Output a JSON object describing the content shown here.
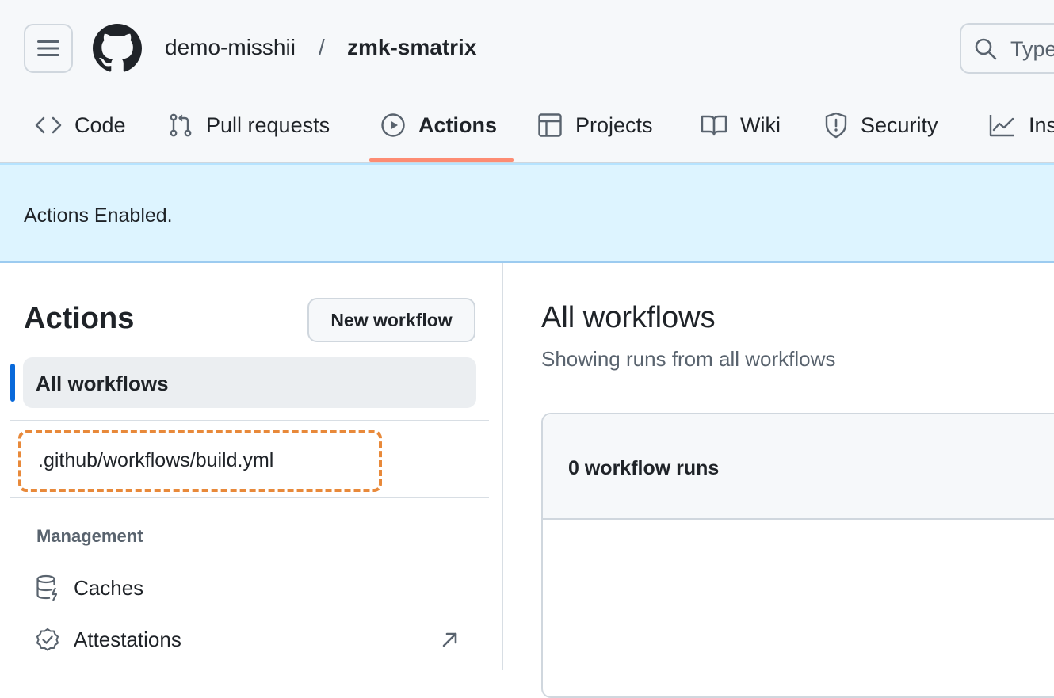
{
  "header": {
    "owner": "demo-misshii",
    "separator": "/",
    "repo": "zmk-smatrix",
    "search_placeholder": "Type"
  },
  "tabs": [
    {
      "label": "Code",
      "icon": "code-icon"
    },
    {
      "label": "Pull requests",
      "icon": "git-pull-request-icon"
    },
    {
      "label": "Actions",
      "icon": "play-icon",
      "active": true
    },
    {
      "label": "Projects",
      "icon": "table-icon"
    },
    {
      "label": "Wiki",
      "icon": "book-icon"
    },
    {
      "label": "Security",
      "icon": "shield-icon"
    },
    {
      "label": "Insights",
      "icon": "graph-icon"
    }
  ],
  "banner": {
    "text": "Actions Enabled."
  },
  "sidebar": {
    "title": "Actions",
    "new_workflow_label": "New workflow",
    "all_workflows_label": "All workflows",
    "workflows": [
      ".github/workflows/build.yml"
    ],
    "management_heading": "Management",
    "management_items": [
      {
        "label": "Caches",
        "icon": "database-icon"
      },
      {
        "label": "Attestations",
        "icon": "verified-icon",
        "external": true
      }
    ]
  },
  "main": {
    "title": "All workflows",
    "subtitle": "Showing runs from all workflows",
    "runs_count": "0 workflow runs"
  },
  "colors": {
    "active_tab_underline": "#fd8c73",
    "banner_bg": "#ddf4ff",
    "active_item_bar": "#0969da",
    "highlight_dashed_border": "#e8893a"
  }
}
